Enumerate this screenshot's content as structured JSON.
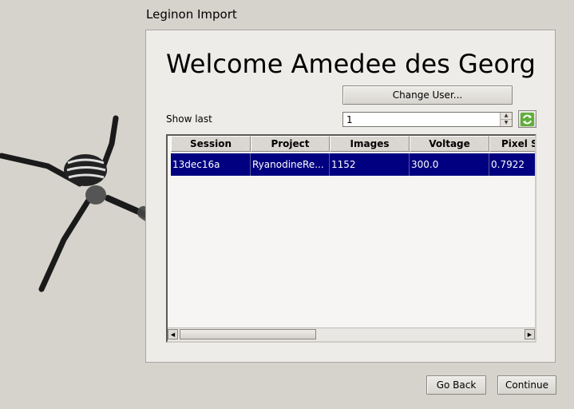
{
  "window": {
    "title": "Leginon Import"
  },
  "welcome": {
    "text": "Welcome Amedee des Georg"
  },
  "buttons": {
    "change_user": "Change User...",
    "go_back": "Go Back",
    "continue": "Continue"
  },
  "show_last": {
    "label": "Show last",
    "value": "1"
  },
  "icons": {
    "refresh": "refresh-icon",
    "spider": "spider-logo"
  },
  "table": {
    "columns": [
      "Session",
      "Project",
      "Images",
      "Voltage",
      "Pixel S"
    ],
    "rows": [
      {
        "session": "13dec16a",
        "project": "RyanodineRe...",
        "images": "1152",
        "voltage": "300.0",
        "pixel_size": "0.7922"
      }
    ],
    "selected_row_color": "#000080"
  }
}
